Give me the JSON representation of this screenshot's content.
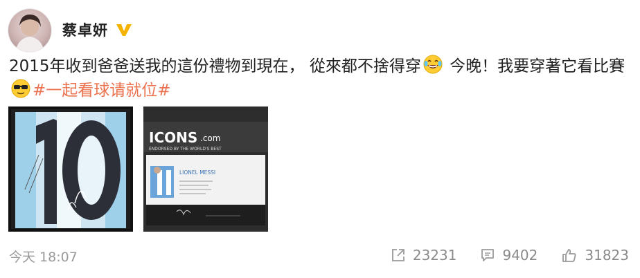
{
  "author": {
    "name": "蔡卓妍",
    "verified_icon": "verified-v-icon"
  },
  "post": {
    "text_part1": "2015年收到爸爸送我的這份禮物到現在， 從來都不捨得穿",
    "emoji1": "laughing-tears-emoji",
    "text_part2": " 今晚！我要穿著它看比賽",
    "emoji2": "sunglasses-emoji",
    "hashtag": "#一起看球请就位#"
  },
  "images": [
    {
      "name": "framed-jersey-number-10",
      "number": "10"
    },
    {
      "name": "certificate-of-authenticity",
      "brand": "ICONS",
      "brand_suffix": ".com",
      "tagline": "ENDORSED BY THE WORLD'S BEST",
      "player": "LIONEL MESSI"
    }
  ],
  "meta": {
    "time": "今天 18:07"
  },
  "actions": {
    "share_count": "23231",
    "comment_count": "9402",
    "like_count": "31823"
  },
  "colors": {
    "hashtag": "#eb7350",
    "verified": "#f5b300",
    "meta": "#999999"
  }
}
